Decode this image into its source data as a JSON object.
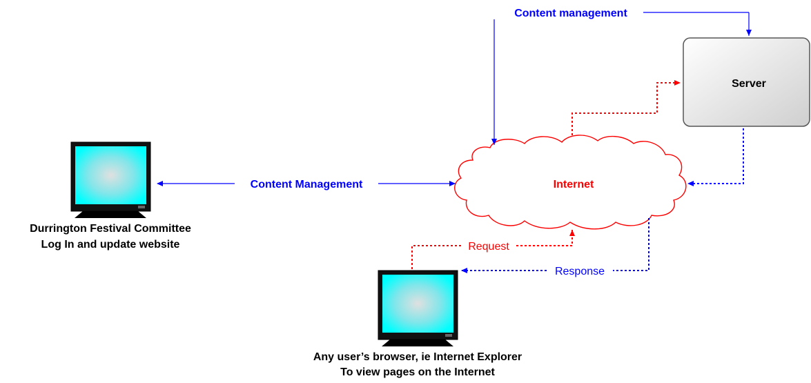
{
  "labels": {
    "content_management_top": "Content management",
    "content_management_left": "Content Management",
    "request": "Request",
    "response": "Response",
    "server": "Server",
    "internet": "Internet",
    "committee_line1": "Durrington Festival Committee",
    "committee_line2": "Log In and update website",
    "user_line1": "Any user’s browser, ie Internet Explorer",
    "user_line2": "To view pages on the Internet"
  },
  "colors": {
    "blue": "#0000ff",
    "red": "#ff0000",
    "black": "#000000",
    "screen": "#00ffff"
  }
}
